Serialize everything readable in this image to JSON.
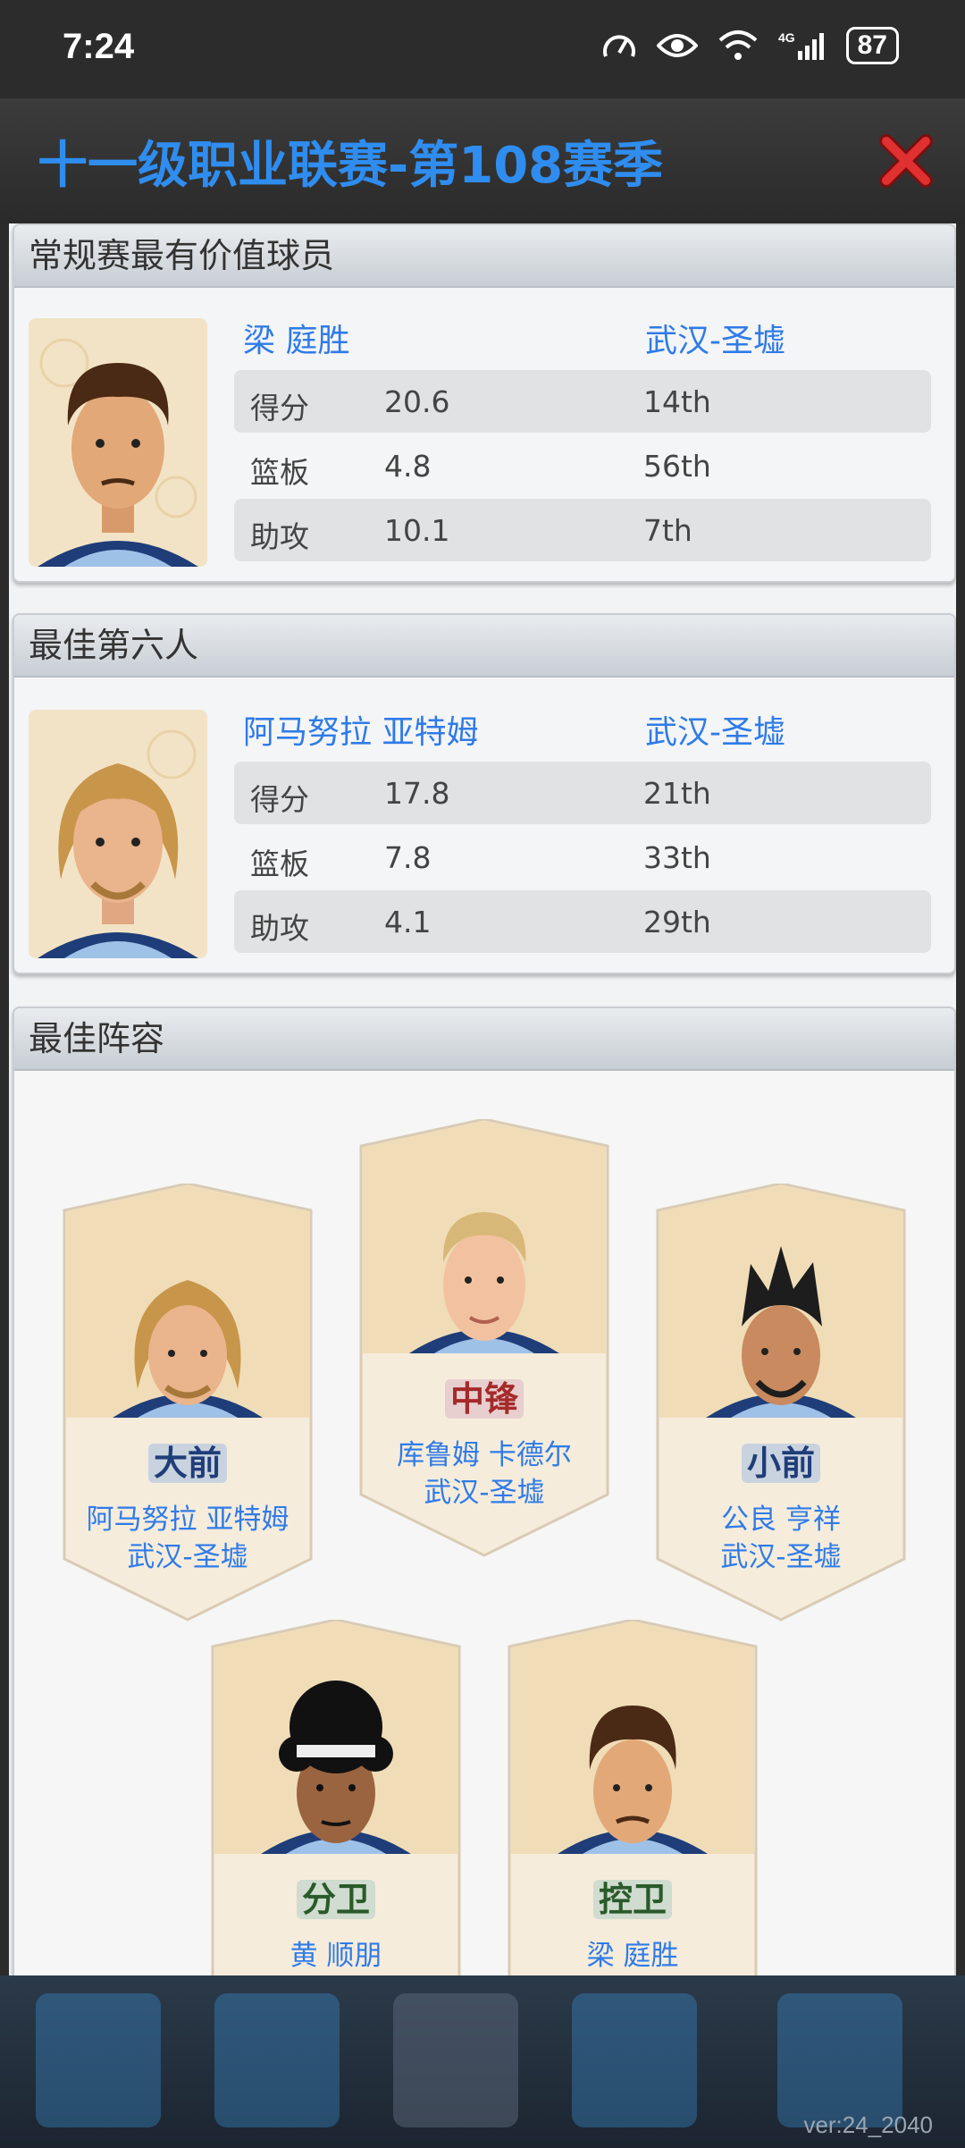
{
  "status_bar": {
    "time": "7:24",
    "battery": "87"
  },
  "header": {
    "title": "十一级职业联赛-第108赛季",
    "close_icon": "close-x-icon",
    "accent": "#2f8df0"
  },
  "mvp": {
    "section_title": "常规赛最有价值球员",
    "player_name": "梁 庭胜",
    "team": "武汉-圣墟",
    "stats": [
      {
        "label": "得分",
        "value": "20.6",
        "rank": "14th"
      },
      {
        "label": "篮板",
        "value": "4.8",
        "rank": "56th"
      },
      {
        "label": "助攻",
        "value": "10.1",
        "rank": "7th"
      }
    ]
  },
  "sixth_man": {
    "section_title": "最佳第六人",
    "player_name": "阿马努拉 亚特姆",
    "team": "武汉-圣墟",
    "stats": [
      {
        "label": "得分",
        "value": "17.8",
        "rank": "21th"
      },
      {
        "label": "篮板",
        "value": "7.8",
        "rank": "33th"
      },
      {
        "label": "助攻",
        "value": "4.1",
        "rank": "29th"
      }
    ]
  },
  "best_lineup": {
    "section_title": "最佳阵容",
    "cards": [
      {
        "position": "大前",
        "name": "阿马努拉 亚特姆",
        "team": "武汉-圣墟"
      },
      {
        "position": "中锋",
        "name": "库鲁姆 卡德尔",
        "team": "武汉-圣墟"
      },
      {
        "position": "小前",
        "name": "公良 亨祥",
        "team": "武汉-圣墟"
      },
      {
        "position": "分卫",
        "name": "黄 顺朋",
        "team": ""
      },
      {
        "position": "控卫",
        "name": "梁 庭胜",
        "team": ""
      }
    ]
  },
  "version": "ver:24_2040"
}
